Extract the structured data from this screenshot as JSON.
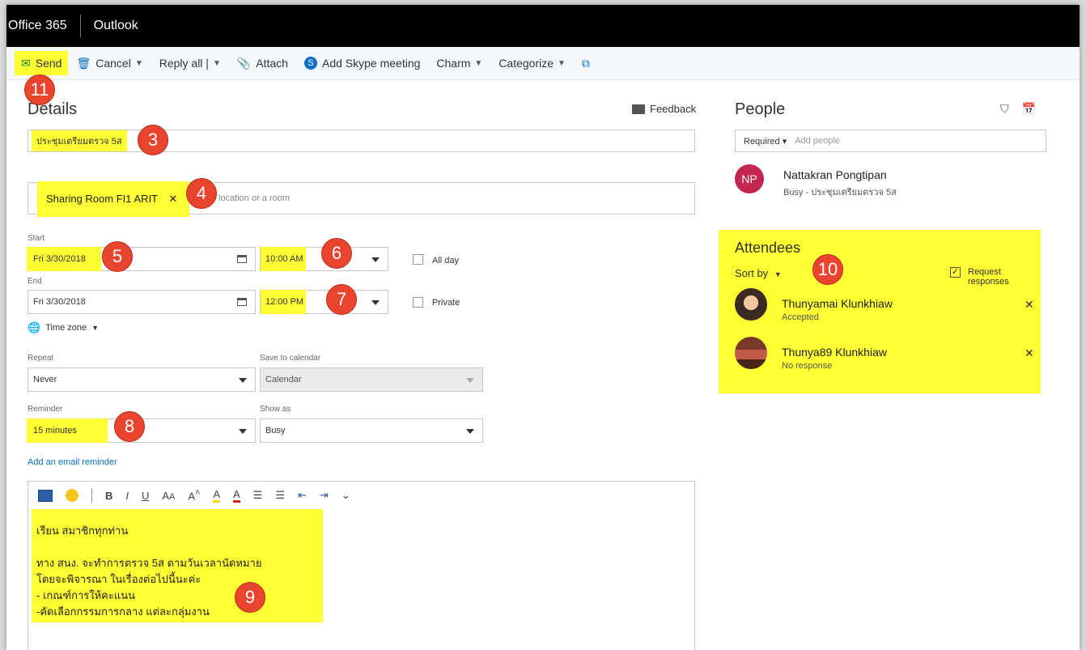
{
  "topbar": {
    "app_name": "Office 365",
    "product": "Outlook"
  },
  "toolbar": {
    "send": "Send",
    "cancel": "Cancel",
    "reply_all": "Reply all |",
    "attach": "Attach",
    "skype": "Add Skype meeting",
    "charm": "Charm",
    "categorize": "Categorize"
  },
  "badges": {
    "b3": "3",
    "b4": "4",
    "b5": "5",
    "b6": "6",
    "b7": "7",
    "b8": "8",
    "b9": "9",
    "b10": "10",
    "b11": "11"
  },
  "details": {
    "heading": "Details",
    "feedback": "Feedback",
    "title_value": "ประชุมเตรียมตรวจ 5ส",
    "location_chip": "Sharing Room FI1 ARIT",
    "location_placeholder": "location or a room",
    "start_label": "Start",
    "start_date": "Fri 3/30/2018",
    "start_time": "10:00 AM",
    "all_day": "All day",
    "end_label": "End",
    "end_date": "Fri 3/30/2018",
    "end_time": "12:00 PM",
    "private": "Private",
    "time_zone": "Time zone",
    "repeat_label": "Repeat",
    "repeat_value": "Never",
    "save_to_label": "Save to calendar",
    "save_to_value": "Calendar",
    "reminder_label": "Reminder",
    "reminder_value": "15 minutes",
    "show_as_label": "Show as",
    "show_as_value": "Busy",
    "email_reminder": "Add an email reminder"
  },
  "editor": {
    "lines": [
      "เรียน สมาชิกทุกท่าน",
      "ทาง สนง. จะทำการตรวจ 5ส   ตามวันเวลานัดหมาย",
      "โดยจะพิจารณา ในเรื่องต่อไปนี้นะค่ะ",
      "- เกณฑ์การให้คะแนน",
      "-คัดเลือกกรรมการกลาง แต่ละกลุ่มงาน"
    ]
  },
  "people": {
    "heading": "People",
    "required": "Required",
    "add_placeholder": "Add people",
    "organizer": {
      "initials": "NP",
      "name": "Nattakran Pongtipan",
      "status": "Busy - ประชุมเตรียมตรวจ 5ส",
      "color": "#c3264f"
    }
  },
  "attendees": {
    "heading": "Attendees",
    "sort_by": "Sort by",
    "request_responses": "Request responses",
    "list": [
      {
        "name": "Thunyamai Klunkhiaw",
        "status": "Accepted"
      },
      {
        "name": "Thunya89 Klunkhiaw",
        "status": "No response"
      }
    ]
  },
  "colors": {
    "highlight": "#ffff33",
    "badge": "#e8442e",
    "link": "#0b6ec6"
  }
}
